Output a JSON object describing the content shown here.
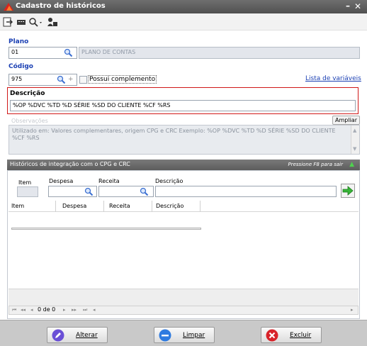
{
  "window": {
    "title": "Cadastro de históricos",
    "min_glyph": "–",
    "close_glyph": "✕"
  },
  "toolbar": {
    "icons": [
      "exit-icon",
      "keyboard-icon",
      "search-icon",
      "users-icon"
    ]
  },
  "plano": {
    "label": "Plano",
    "code": "01",
    "name": "PLANO DE CONTAS"
  },
  "codigo": {
    "label": "Código",
    "value": "975",
    "plus": "+",
    "checkbox_label": "Possui complemento",
    "link": "Lista de variáveis"
  },
  "descricao": {
    "label": "Descrição",
    "value": "%OP %DVC %TD %D SÉRIE %SD DO CLIENTE %CF %RS"
  },
  "observacoes": {
    "label": "Observações",
    "ampliar": "Ampliar",
    "text": "Utilizado em: Valores complementares, origem CPG e CRC Exemplo: %OP %DVC %TD %D SÉRIE %SD DO CLIENTE %CF %RS"
  },
  "integracao": {
    "title": "Históricos de integração com o CPG e CRC",
    "hint": "Pressione F8 para sair",
    "fields": {
      "item": "Item",
      "despesa": "Despesa",
      "receita": "Receita",
      "descricao": "Descrição"
    },
    "columns": [
      "Item",
      "Despesa",
      "Receita",
      "Descrição"
    ],
    "nav": {
      "first": "⏮",
      "prev_page": "◂◂",
      "prev": "◂",
      "record": "0 de 0",
      "next": "▸",
      "next_page": "▸▸",
      "last": "⏭",
      "scroll_left": "◂",
      "scroll_right": "▸"
    }
  },
  "buttons": {
    "alterar": "Alterar",
    "limpar": "Limpar",
    "excluir": "Excluir"
  },
  "colors": {
    "accent": "#1a3fb3",
    "title_bar": "#5a5a5a",
    "highlight_border": "#d01818"
  }
}
